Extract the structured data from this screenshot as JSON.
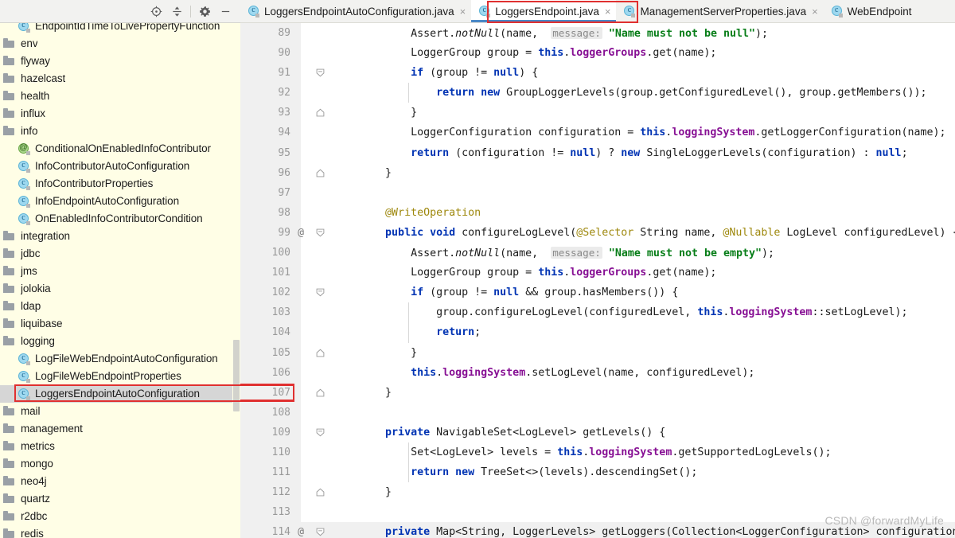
{
  "panel": {
    "toolbar_icons": [
      {
        "name": "locate-icon",
        "glyph": "locate"
      },
      {
        "name": "collapse-all-icon",
        "glyph": "collapse"
      },
      {
        "name": "settings-gear-icon",
        "glyph": "gear"
      },
      {
        "name": "hide-panel-icon",
        "glyph": "minus"
      }
    ],
    "tree": [
      {
        "label": "EndpointIdTimeToLivePropertyFunction",
        "icon": "class",
        "indent": 1,
        "selected": false,
        "clipped_top": true
      },
      {
        "label": "env",
        "icon": "folder",
        "indent": 0,
        "selected": false
      },
      {
        "label": "flyway",
        "icon": "folder",
        "indent": 0,
        "selected": false
      },
      {
        "label": "hazelcast",
        "icon": "folder",
        "indent": 0,
        "selected": false
      },
      {
        "label": "health",
        "icon": "folder",
        "indent": 0,
        "selected": false
      },
      {
        "label": "influx",
        "icon": "folder",
        "indent": 0,
        "selected": false
      },
      {
        "label": "info",
        "icon": "folder",
        "indent": 0,
        "selected": false
      },
      {
        "label": "ConditionalOnEnabledInfoContributor",
        "icon": "annotation",
        "indent": 1,
        "selected": false
      },
      {
        "label": "InfoContributorAutoConfiguration",
        "icon": "class",
        "indent": 1,
        "selected": false
      },
      {
        "label": "InfoContributorProperties",
        "icon": "class",
        "indent": 1,
        "selected": false
      },
      {
        "label": "InfoEndpointAutoConfiguration",
        "icon": "class",
        "indent": 1,
        "selected": false
      },
      {
        "label": "OnEnabledInfoContributorCondition",
        "icon": "class",
        "indent": 1,
        "selected": false
      },
      {
        "label": "integration",
        "icon": "folder",
        "indent": 0,
        "selected": false
      },
      {
        "label": "jdbc",
        "icon": "folder",
        "indent": 0,
        "selected": false
      },
      {
        "label": "jms",
        "icon": "folder",
        "indent": 0,
        "selected": false
      },
      {
        "label": "jolokia",
        "icon": "folder",
        "indent": 0,
        "selected": false
      },
      {
        "label": "ldap",
        "icon": "folder",
        "indent": 0,
        "selected": false
      },
      {
        "label": "liquibase",
        "icon": "folder",
        "indent": 0,
        "selected": false
      },
      {
        "label": "logging",
        "icon": "folder",
        "indent": 0,
        "selected": false
      },
      {
        "label": "LogFileWebEndpointAutoConfiguration",
        "icon": "class",
        "indent": 1,
        "selected": false
      },
      {
        "label": "LogFileWebEndpointProperties",
        "icon": "class",
        "indent": 1,
        "selected": false
      },
      {
        "label": "LoggersEndpointAutoConfiguration",
        "icon": "class",
        "indent": 1,
        "selected": true
      },
      {
        "label": "mail",
        "icon": "folder",
        "indent": 0,
        "selected": false
      },
      {
        "label": "management",
        "icon": "folder",
        "indent": 0,
        "selected": false
      },
      {
        "label": "metrics",
        "icon": "folder",
        "indent": 0,
        "selected": false
      },
      {
        "label": "mongo",
        "icon": "folder",
        "indent": 0,
        "selected": false
      },
      {
        "label": "neo4j",
        "icon": "folder",
        "indent": 0,
        "selected": false
      },
      {
        "label": "quartz",
        "icon": "folder",
        "indent": 0,
        "selected": false
      },
      {
        "label": "r2dbc",
        "icon": "folder",
        "indent": 0,
        "selected": false
      },
      {
        "label": "redis",
        "icon": "folder",
        "indent": 0,
        "selected": false
      }
    ]
  },
  "editor": {
    "tabs": [
      {
        "label": "LoggersEndpointAutoConfiguration.java",
        "active": false,
        "close": "×"
      },
      {
        "label": "LoggersEndpoint.java",
        "active": true,
        "close": "×"
      },
      {
        "label": "ManagementServerProperties.java",
        "active": false,
        "close": "×"
      },
      {
        "label": "WebEndpoint",
        "active": false,
        "close": ""
      }
    ],
    "lines": [
      {
        "num": "89",
        "at": "",
        "fold": "",
        "indent_guides": [],
        "tokens": [
          {
            "t": "            Assert.",
            "c": "plain"
          },
          {
            "t": "notNull",
            "c": "ital"
          },
          {
            "t": "(name,  ",
            "c": "plain"
          },
          {
            "t": "message:",
            "c": "hint"
          },
          {
            "t": " ",
            "c": "plain"
          },
          {
            "t": "\"Name must not be null\"",
            "c": "str"
          },
          {
            "t": ");",
            "c": "plain"
          }
        ]
      },
      {
        "num": "90",
        "at": "",
        "fold": "",
        "indent_guides": [],
        "tokens": [
          {
            "t": "            LoggerGroup group = ",
            "c": "plain"
          },
          {
            "t": "this",
            "c": "kw"
          },
          {
            "t": ".",
            "c": "plain"
          },
          {
            "t": "loggerGroups",
            "c": "fld"
          },
          {
            "t": ".get(name);",
            "c": "plain"
          }
        ]
      },
      {
        "num": "91",
        "at": "",
        "fold": "open",
        "indent_guides": [],
        "tokens": [
          {
            "t": "            ",
            "c": "plain"
          },
          {
            "t": "if",
            "c": "kw"
          },
          {
            "t": " (group != ",
            "c": "plain"
          },
          {
            "t": "null",
            "c": "kw"
          },
          {
            "t": ") {",
            "c": "plain"
          }
        ]
      },
      {
        "num": "92",
        "at": "",
        "fold": "",
        "indent_guides": [
          92
        ],
        "tokens": [
          {
            "t": "                ",
            "c": "plain"
          },
          {
            "t": "return new",
            "c": "kw"
          },
          {
            "t": " GroupLoggerLevels(group.getConfiguredLevel(), group.getMembers());",
            "c": "plain"
          }
        ]
      },
      {
        "num": "93",
        "at": "",
        "fold": "close",
        "indent_guides": [],
        "tokens": [
          {
            "t": "            }",
            "c": "plain"
          }
        ]
      },
      {
        "num": "94",
        "at": "",
        "fold": "",
        "indent_guides": [],
        "tokens": [
          {
            "t": "            LoggerConfiguration configuration = ",
            "c": "plain"
          },
          {
            "t": "this",
            "c": "kw"
          },
          {
            "t": ".",
            "c": "plain"
          },
          {
            "t": "loggingSystem",
            "c": "fld"
          },
          {
            "t": ".getLoggerConfiguration(name);",
            "c": "plain"
          }
        ]
      },
      {
        "num": "95",
        "at": "",
        "fold": "",
        "indent_guides": [],
        "tokens": [
          {
            "t": "            ",
            "c": "plain"
          },
          {
            "t": "return",
            "c": "kw"
          },
          {
            "t": " (configuration != ",
            "c": "plain"
          },
          {
            "t": "null",
            "c": "kw"
          },
          {
            "t": ") ? ",
            "c": "plain"
          },
          {
            "t": "new",
            "c": "kw"
          },
          {
            "t": " SingleLoggerLevels(configuration) : ",
            "c": "plain"
          },
          {
            "t": "null",
            "c": "kw"
          },
          {
            "t": ";",
            "c": "plain"
          }
        ]
      },
      {
        "num": "96",
        "at": "",
        "fold": "close",
        "indent_guides": [],
        "tokens": [
          {
            "t": "        }",
            "c": "plain"
          }
        ]
      },
      {
        "num": "97",
        "at": "",
        "fold": "",
        "indent_guides": [],
        "tokens": []
      },
      {
        "num": "98",
        "at": "",
        "fold": "",
        "indent_guides": [],
        "tokens": [
          {
            "t": "        ",
            "c": "plain"
          },
          {
            "t": "@WriteOperation",
            "c": "ann"
          }
        ]
      },
      {
        "num": "99",
        "at": "@",
        "fold": "open",
        "indent_guides": [],
        "tokens": [
          {
            "t": "        ",
            "c": "plain"
          },
          {
            "t": "public void",
            "c": "kw"
          },
          {
            "t": " configureLogLevel(",
            "c": "plain"
          },
          {
            "t": "@Selector",
            "c": "ann"
          },
          {
            "t": " String name, ",
            "c": "plain"
          },
          {
            "t": "@Nullable",
            "c": "ann"
          },
          {
            "t": " LogLevel configuredLevel) {",
            "c": "plain"
          }
        ]
      },
      {
        "num": "100",
        "at": "",
        "fold": "",
        "indent_guides": [],
        "tokens": [
          {
            "t": "            Assert.",
            "c": "plain"
          },
          {
            "t": "notNull",
            "c": "ital"
          },
          {
            "t": "(name,  ",
            "c": "plain"
          },
          {
            "t": "message:",
            "c": "hint"
          },
          {
            "t": " ",
            "c": "plain"
          },
          {
            "t": "\"Name must not be empty\"",
            "c": "str"
          },
          {
            "t": ");",
            "c": "plain"
          }
        ]
      },
      {
        "num": "101",
        "at": "",
        "fold": "",
        "indent_guides": [],
        "tokens": [
          {
            "t": "            LoggerGroup group = ",
            "c": "plain"
          },
          {
            "t": "this",
            "c": "kw"
          },
          {
            "t": ".",
            "c": "plain"
          },
          {
            "t": "loggerGroups",
            "c": "fld"
          },
          {
            "t": ".get(name);",
            "c": "plain"
          }
        ]
      },
      {
        "num": "102",
        "at": "",
        "fold": "open",
        "indent_guides": [],
        "tokens": [
          {
            "t": "            ",
            "c": "plain"
          },
          {
            "t": "if",
            "c": "kw"
          },
          {
            "t": " (group != ",
            "c": "plain"
          },
          {
            "t": "null",
            "c": "kw"
          },
          {
            "t": " && group.hasMembers()) {",
            "c": "plain"
          }
        ]
      },
      {
        "num": "103",
        "at": "",
        "fold": "",
        "indent_guides": [
          103
        ],
        "tokens": [
          {
            "t": "                group.configureLogLevel(configuredLevel, ",
            "c": "plain"
          },
          {
            "t": "this",
            "c": "kw"
          },
          {
            "t": ".",
            "c": "plain"
          },
          {
            "t": "loggingSystem",
            "c": "fld"
          },
          {
            "t": "::setLogLevel);",
            "c": "plain"
          }
        ]
      },
      {
        "num": "104",
        "at": "",
        "fold": "",
        "indent_guides": [
          104
        ],
        "tokens": [
          {
            "t": "                ",
            "c": "plain"
          },
          {
            "t": "return",
            "c": "kw"
          },
          {
            "t": ";",
            "c": "plain"
          }
        ]
      },
      {
        "num": "105",
        "at": "",
        "fold": "close",
        "indent_guides": [],
        "tokens": [
          {
            "t": "            }",
            "c": "plain"
          }
        ]
      },
      {
        "num": "106",
        "at": "",
        "fold": "",
        "indent_guides": [],
        "tokens": [
          {
            "t": "            ",
            "c": "plain"
          },
          {
            "t": "this",
            "c": "kw"
          },
          {
            "t": ".",
            "c": "plain"
          },
          {
            "t": "loggingSystem",
            "c": "fld"
          },
          {
            "t": ".setLogLevel(name, configuredLevel);",
            "c": "plain"
          }
        ]
      },
      {
        "num": "107",
        "at": "",
        "fold": "close",
        "indent_guides": [],
        "tokens": [
          {
            "t": "        }",
            "c": "plain"
          }
        ]
      },
      {
        "num": "108",
        "at": "",
        "fold": "",
        "indent_guides": [],
        "tokens": []
      },
      {
        "num": "109",
        "at": "",
        "fold": "open",
        "indent_guides": [],
        "tokens": [
          {
            "t": "        ",
            "c": "plain"
          },
          {
            "t": "private",
            "c": "kw"
          },
          {
            "t": " NavigableSet<LogLevel> getLevels() {",
            "c": "plain"
          }
        ]
      },
      {
        "num": "110",
        "at": "",
        "fold": "",
        "indent_guides": [
          110
        ],
        "tokens": [
          {
            "t": "            Set<LogLevel> levels = ",
            "c": "plain"
          },
          {
            "t": "this",
            "c": "kw"
          },
          {
            "t": ".",
            "c": "plain"
          },
          {
            "t": "loggingSystem",
            "c": "fld"
          },
          {
            "t": ".getSupportedLogLevels();",
            "c": "plain"
          }
        ]
      },
      {
        "num": "111",
        "at": "",
        "fold": "",
        "indent_guides": [
          111
        ],
        "tokens": [
          {
            "t": "            ",
            "c": "plain"
          },
          {
            "t": "return new",
            "c": "kw"
          },
          {
            "t": " TreeSet<>(levels).descendingSet();",
            "c": "plain"
          }
        ]
      },
      {
        "num": "112",
        "at": "",
        "fold": "close",
        "indent_guides": [],
        "tokens": [
          {
            "t": "        }",
            "c": "plain"
          }
        ]
      },
      {
        "num": "113",
        "at": "",
        "fold": "",
        "indent_guides": [],
        "tokens": []
      },
      {
        "num": "114",
        "at": "@",
        "fold": "open",
        "indent_guides": [],
        "cut": true,
        "tokens": [
          {
            "t": "        ",
            "c": "plain"
          },
          {
            "t": "private",
            "c": "kw"
          },
          {
            "t": " Map<String, LoggerLevels> getLoggers(Collection<LoggerConfiguration> configurations) {",
            "c": "plain"
          }
        ]
      }
    ]
  },
  "annotations": {
    "tab_highlight_target": "LoggersEndpoint.java",
    "tree_highlight_target": "LoggersEndpointAutoConfiguration",
    "box_color": "#e03030"
  },
  "watermark": {
    "text": "CSDN @forwardMyLife"
  }
}
